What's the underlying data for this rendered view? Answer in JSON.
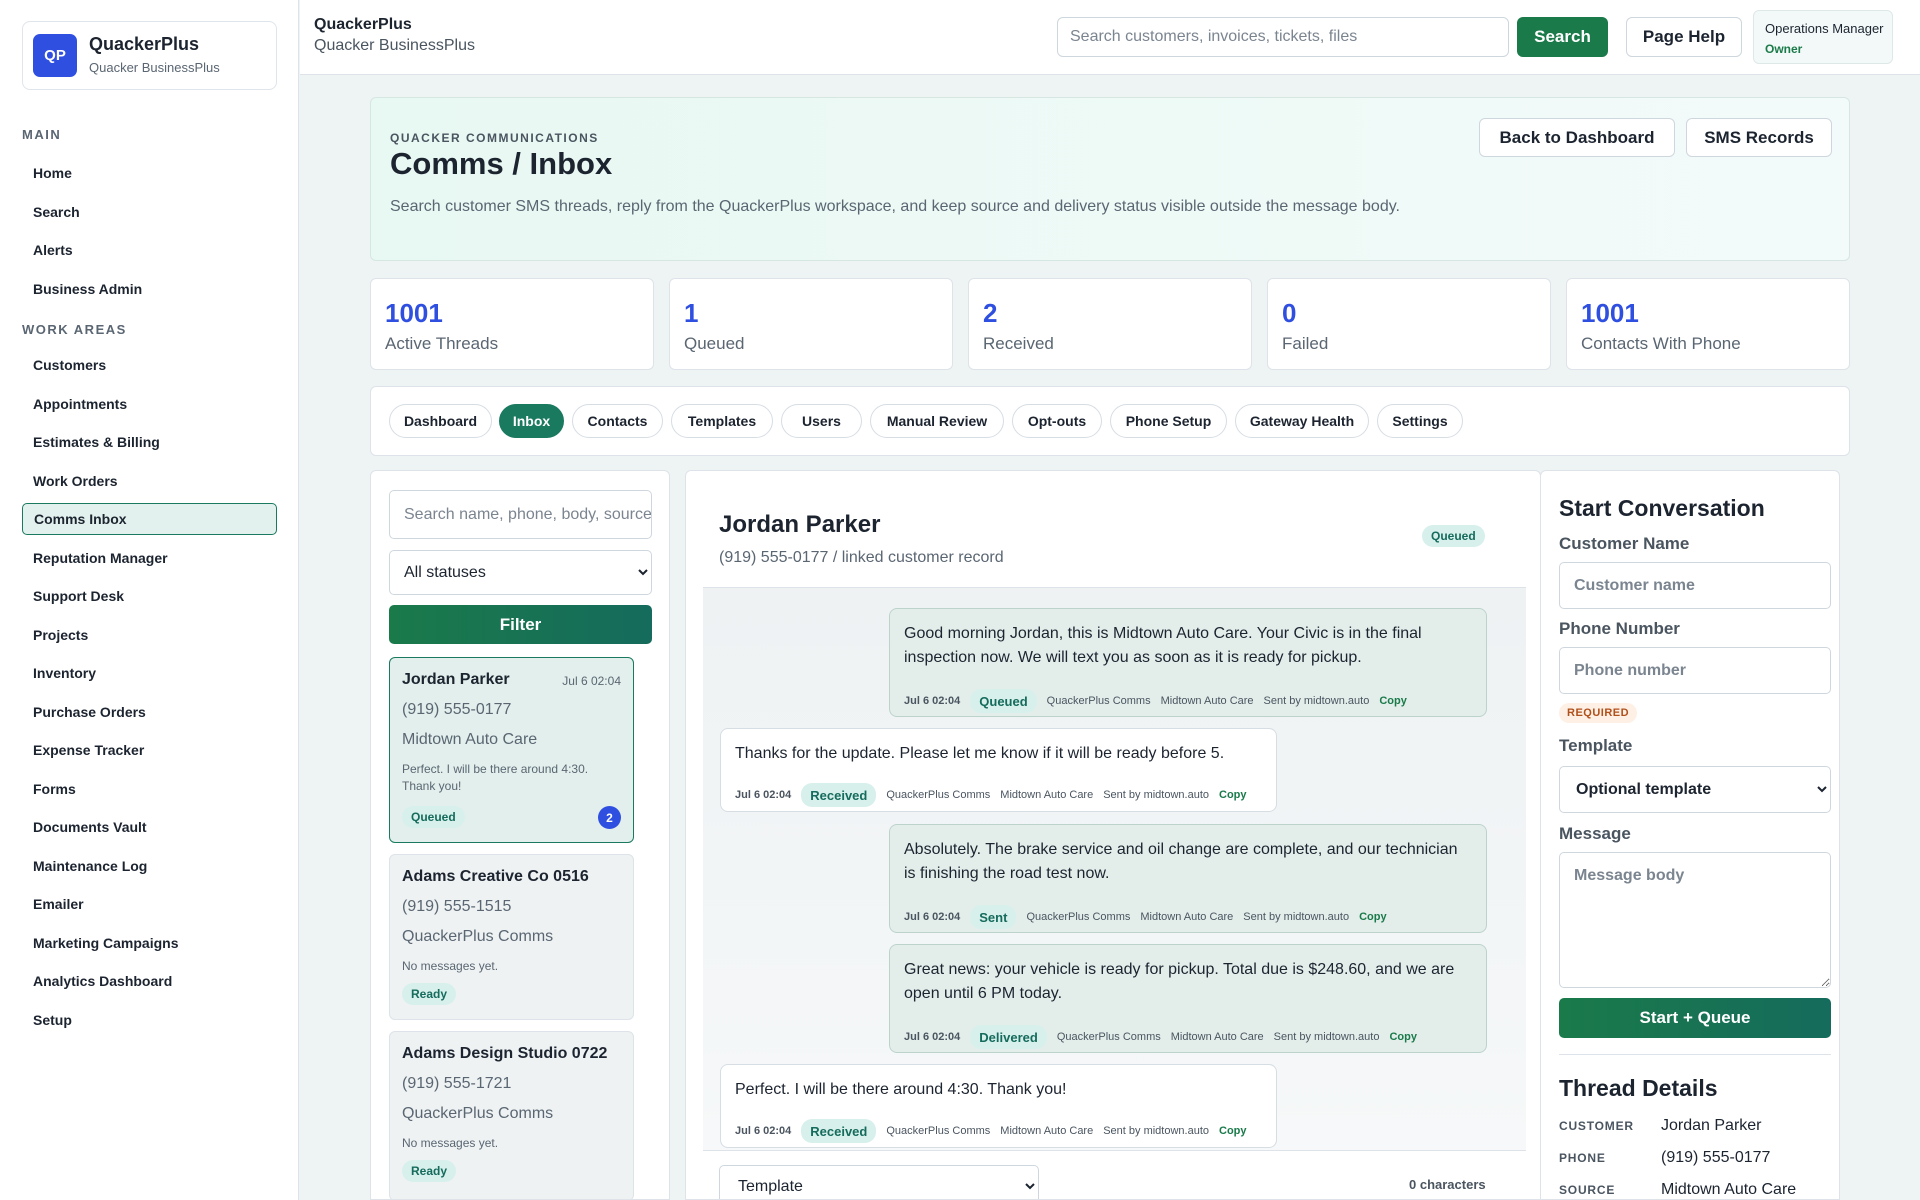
{
  "brand": {
    "logo": "QP",
    "name": "QuackerPlus",
    "sub": "Quacker BusinessPlus"
  },
  "nav": {
    "main_heading": "MAIN",
    "main": [
      "Home",
      "Search",
      "Alerts",
      "Business Admin"
    ],
    "work_heading": "WORK AREAS",
    "work": [
      "Customers",
      "Appointments",
      "Estimates & Billing",
      "Work Orders",
      "Comms Inbox",
      "Reputation Manager",
      "Support Desk",
      "Projects",
      "Inventory",
      "Purchase Orders",
      "Expense Tracker",
      "Forms",
      "Documents Vault",
      "Maintenance Log",
      "Emailer",
      "Marketing Campaigns",
      "Analytics Dashboard",
      "Setup"
    ],
    "active": "Comms Inbox"
  },
  "topbar": {
    "title": "QuackerPlus",
    "subtitle": "Quacker BusinessPlus",
    "search_placeholder": "Search customers, invoices, tickets, files",
    "search_button": "Search",
    "help_button": "Page Help",
    "user_role": "Operations Manager",
    "user_level": "Owner"
  },
  "hero": {
    "eyebrow": "QUACKER COMMUNICATIONS",
    "title": "Comms / Inbox",
    "description": "Search customer SMS threads, reply from the QuackerPlus workspace, and keep source and delivery status visible outside the message body.",
    "back_button": "Back to Dashboard",
    "records_button": "SMS Records"
  },
  "stats": [
    {
      "value": "1001",
      "label": "Active Threads"
    },
    {
      "value": "1",
      "label": "Queued"
    },
    {
      "value": "2",
      "label": "Received"
    },
    {
      "value": "0",
      "label": "Failed"
    },
    {
      "value": "1001",
      "label": "Contacts With Phone"
    }
  ],
  "tabs": [
    "Dashboard",
    "Inbox",
    "Contacts",
    "Templates",
    "Users",
    "Manual Review",
    "Opt-outs",
    "Phone Setup",
    "Gateway Health",
    "Settings"
  ],
  "active_tab": "Inbox",
  "threads": {
    "search_placeholder": "Search name, phone, body, source",
    "status_filter": "All statuses",
    "filter_button": "Filter",
    "items": [
      {
        "name": "Jordan Parker",
        "time": "Jul 6 02:04",
        "phone": "(919) 555-0177",
        "source": "Midtown Auto Care",
        "preview": "Perfect. I will be there around 4:30. Thank you!",
        "status": "Queued",
        "unread": "2"
      },
      {
        "name": "Adams Creative Co 0516",
        "time": "",
        "phone": "(919) 555-1515",
        "source": "QuackerPlus Comms",
        "preview": "No messages yet.",
        "status": "Ready",
        "unread": ""
      },
      {
        "name": "Adams Design Studio 0722",
        "time": "",
        "phone": "(919) 555-1721",
        "source": "QuackerPlus Comms",
        "preview": "No messages yet.",
        "status": "Ready",
        "unread": ""
      }
    ]
  },
  "conversation": {
    "name": "Jordan Parker",
    "subtitle": "(919) 555-0177 / linked customer record",
    "status": "Queued",
    "messages": [
      {
        "direction": "out",
        "body": "Good morning Jordan, this is Midtown Auto Care. Your Civic is in the final inspection now. We will text you as soon as it is ready for pickup.",
        "time": "Jul 6 02:04",
        "status": "Queued",
        "channel": "QuackerPlus Comms",
        "source": "Midtown Auto Care",
        "sender": "Sent by midtown.auto",
        "copy": "Copy"
      },
      {
        "direction": "in",
        "body": "Thanks for the update. Please let me know if it will be ready before 5.",
        "time": "Jul 6 02:04",
        "status": "Received",
        "channel": "QuackerPlus Comms",
        "source": "Midtown Auto Care",
        "sender": "Sent by midtown.auto",
        "copy": "Copy"
      },
      {
        "direction": "out",
        "body": "Absolutely. The brake service and oil change are complete, and our technician is finishing the road test now.",
        "time": "Jul 6 02:04",
        "status": "Sent",
        "channel": "QuackerPlus Comms",
        "source": "Midtown Auto Care",
        "sender": "Sent by midtown.auto",
        "copy": "Copy"
      },
      {
        "direction": "out",
        "body": "Great news: your vehicle is ready for pickup. Total due is $248.60, and we are open until 6 PM today.",
        "time": "Jul 6 02:04",
        "status": "Delivered",
        "channel": "QuackerPlus Comms",
        "source": "Midtown Auto Care",
        "sender": "Sent by midtown.auto",
        "copy": "Copy"
      },
      {
        "direction": "in",
        "body": "Perfect. I will be there around 4:30. Thank you!",
        "time": "Jul 6 02:04",
        "status": "Received",
        "channel": "QuackerPlus Comms",
        "source": "Midtown Auto Care",
        "sender": "Sent by midtown.auto",
        "copy": "Copy"
      }
    ],
    "template_select": "Template",
    "char_count": "0 characters"
  },
  "start": {
    "title": "Start Conversation",
    "name_label": "Customer Name",
    "name_placeholder": "Customer name",
    "phone_label": "Phone Number",
    "phone_placeholder": "Phone number",
    "required": "REQUIRED",
    "template_label": "Template",
    "template_select": "Optional template",
    "message_label": "Message",
    "message_placeholder": "Message body",
    "button": "Start + Queue"
  },
  "details": {
    "title": "Thread Details",
    "rows": [
      {
        "key": "CUSTOMER",
        "value": "Jordan Parker"
      },
      {
        "key": "PHONE",
        "value": "(919) 555-0177"
      },
      {
        "key": "SOURCE",
        "value": "Midtown Auto Care"
      }
    ]
  }
}
